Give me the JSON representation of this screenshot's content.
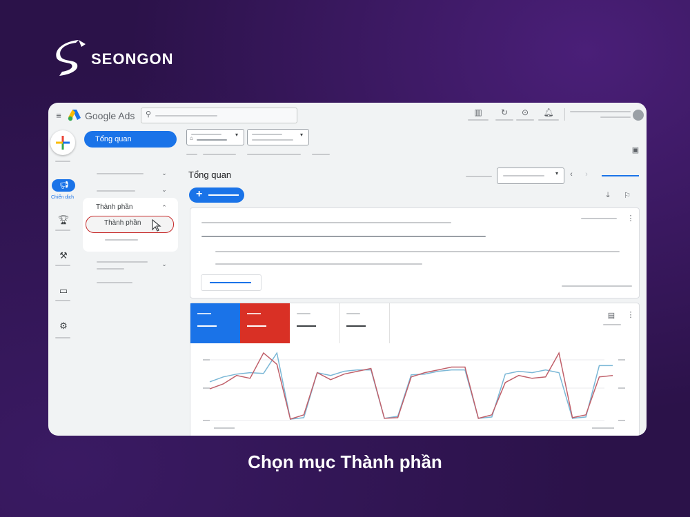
{
  "brand": {
    "name": "SEONGON"
  },
  "app": {
    "title": "Google Ads"
  },
  "nav": {
    "overview_label": "Tổng quan",
    "section_label": "Thành phần",
    "selected_item_label": "Thành phần",
    "campaign_label": "Chiến dịch"
  },
  "main": {
    "page_title": "Tổng quan",
    "add_button_icon": "+"
  },
  "caption": "Chọn mục Thành phần",
  "colors": {
    "accent_blue": "#1a73e8",
    "accent_red": "#d93025",
    "line_blue": "#7ab7d6",
    "line_red": "#c0606a"
  },
  "chart_data": {
    "type": "line",
    "series": [
      {
        "values": [
          55,
          62,
          66,
          68,
          67,
          96,
          2,
          4,
          68,
          64,
          70,
          72,
          72,
          3,
          6,
          65,
          66,
          70,
          72,
          72,
          3,
          5,
          66,
          70,
          68,
          72,
          68,
          3,
          5,
          78,
          78
        ]
      },
      {
        "values": [
          45,
          52,
          64,
          60,
          96,
          80,
          2,
          8,
          68,
          58,
          66,
          70,
          74,
          3,
          4,
          62,
          68,
          72,
          76,
          76,
          3,
          8,
          54,
          64,
          60,
          62,
          96,
          4,
          8,
          62,
          64
        ]
      }
    ],
    "ylim": [
      0,
      100
    ]
  }
}
